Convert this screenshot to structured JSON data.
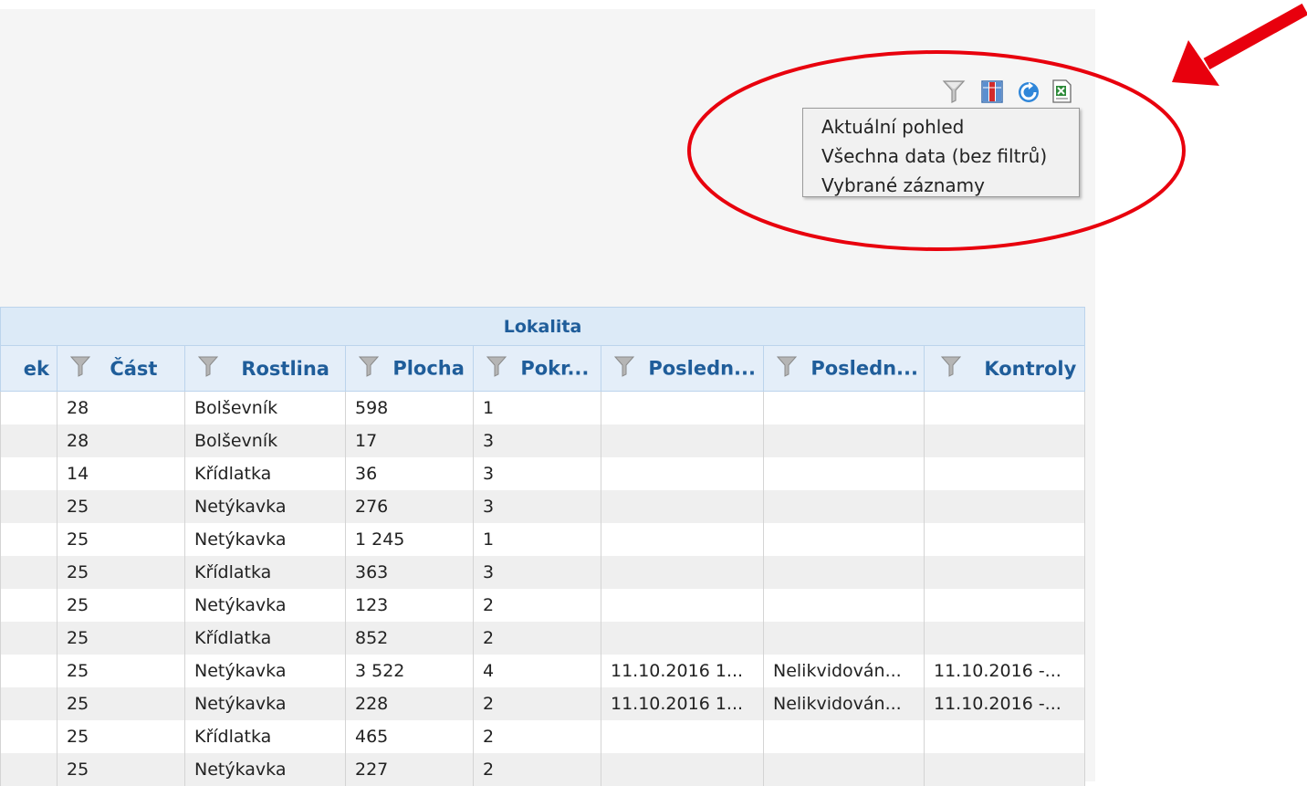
{
  "toolbar": {
    "icons": [
      "filter-icon",
      "columns-icon",
      "refresh-icon",
      "excel-export-icon"
    ]
  },
  "export_menu": {
    "items": [
      "Aktuální pohled",
      "Všechna data (bez filtrů)",
      "Vybrané záznamy"
    ]
  },
  "grid": {
    "group_header": "Lokalita",
    "columns": [
      "ek",
      "Část",
      "Rostlina",
      "Plocha",
      "Pokr...",
      "Posledn...",
      "Posledn...",
      "Kontroly"
    ],
    "rows": [
      [
        "",
        "28",
        "Bolševník",
        "598",
        "1",
        "",
        "",
        ""
      ],
      [
        "",
        "28",
        "Bolševník",
        "17",
        "3",
        "",
        "",
        ""
      ],
      [
        "",
        "14",
        "Křídlatka",
        "36",
        "3",
        "",
        "",
        ""
      ],
      [
        "",
        "25",
        "Netýkavka",
        "276",
        "3",
        "",
        "",
        ""
      ],
      [
        "",
        "25",
        "Netýkavka",
        "1 245",
        "1",
        "",
        "",
        ""
      ],
      [
        "",
        "25",
        "Křídlatka",
        "363",
        "3",
        "",
        "",
        ""
      ],
      [
        "",
        "25",
        "Netýkavka",
        "123",
        "2",
        "",
        "",
        ""
      ],
      [
        "",
        "25",
        "Křídlatka",
        "852",
        "2",
        "",
        "",
        ""
      ],
      [
        "",
        "25",
        "Netýkavka",
        "3 522",
        "4",
        "11.10.2016 1...",
        "Nelikvidován...",
        "11.10.2016 -..."
      ],
      [
        "",
        "25",
        "Netýkavka",
        "228",
        "2",
        "11.10.2016 1...",
        "Nelikvidován...",
        "11.10.2016 -..."
      ],
      [
        "",
        "25",
        "Křídlatka",
        "465",
        "2",
        "",
        "",
        ""
      ],
      [
        "",
        "25",
        "Netýkavka",
        "227",
        "2",
        "",
        "",
        ""
      ]
    ]
  },
  "colors": {
    "header_text": "#1f5d9a",
    "header_bg": "#dceaf7",
    "annotation_red": "#e8000d"
  }
}
